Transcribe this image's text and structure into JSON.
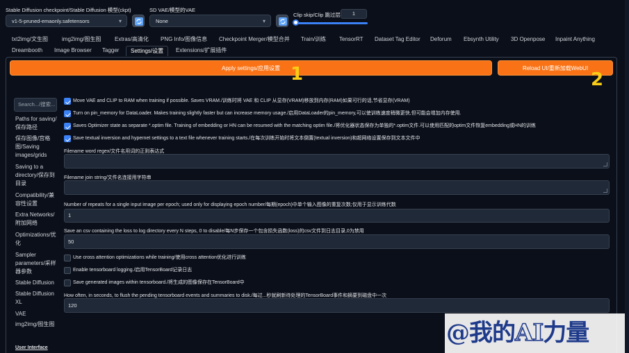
{
  "header": {
    "checkpoint_label": "Stable Diffusion checkpoint/Stable Diffusion 模型(ckpt)",
    "checkpoint_value": "v1-5-pruned-emaonly.safetensors",
    "vae_label": "SD VAE/模型的VAE",
    "vae_value": "None",
    "clip_label": "Clip skip/Clip 跳过层",
    "clip_value": "1",
    "clip_fill_fraction": 0.0
  },
  "tabs": [
    "txt2img/文生图",
    "img2img/图生图",
    "Extras/高清化",
    "PNG Info/图像信息",
    "Checkpoint Merger/模型合并",
    "Train/训练",
    "TensorRT",
    "Dataset Tag Editor",
    "Deforum",
    "Ebsynth Utility",
    "3D Openpose",
    "Inpaint Anything",
    "Dreambooth",
    "Image Browser",
    "Tagger",
    "Settings/设置",
    "Extensions/扩展插件"
  ],
  "actions": {
    "apply": "Apply settings/应用设置",
    "reload": "Reload UI/重新加载WebUI"
  },
  "annotations": [
    "1",
    "2"
  ],
  "sidebar": {
    "search_placeholder": "Search.../搜索...",
    "items": [
      "Paths for saving/保存路径",
      "保存图像/宫格图/Saving images/grids",
      "Saving to a directory/保存到目录",
      "Compatibility/兼容性设置",
      "Extra Networks/附加网络",
      "Optimizations/优化",
      "Sampler parameters/采样器参数",
      "Stable Diffusion",
      "Stable Diffusion XL",
      "VAE",
      "img2img/图生图",
      "User Interface"
    ]
  },
  "settings": {
    "cb1": "Move VAE and CLIP to RAM when training if possible. Saves VRAM./训练时将 VAE 和 CLIP 从显存(VRAM)移放到内存(RAM)如果可行的话,节省显存(VRAM)",
    "cb2": "Turn on pin_memory for DataLoader. Makes training slightly faster but can increase memory usage./启用DataLoader的pin_memory,可以使训练速度稍微更快,但可能会增加内存使用.",
    "cb3": "Saves Optimizer state as separate *.optim file. Training of embedding or HN can be resumed with the matching optim file./将优化器状态保存为单独的*.optim文件.可以使用匹配的optim文件恢复embedding或HN的训练",
    "cb4": "Save textual inversion and hypernet settings to a text file whenever training starts./在每次训练开始时将文本倒置(textual inversion)和超网络设置保存到文本文件中",
    "word_regex_label": "Filename word regex/文件名用词的正则表达式",
    "word_regex_value": "",
    "join_label": "Filename join string/文件名连接用字符串",
    "join_value": "",
    "repeats_label": "Number of repeats for a single input image per epoch; used only for displaying epoch number/每期(epoch)中单个输入图像的重复次数;仅用于显示训练代数",
    "repeats_value": "1",
    "csv_label": "Save an csv containing the loss to log directory every N steps, 0 to disable/每N步保存一个包含损失函数(loss)的csv文件到日志目录,0为禁用",
    "csv_value": "50",
    "cb5": "Use cross attention optimizations while training/使用cross attention优化进行训练",
    "cb6": "Enable tensorboard logging./启用TensorBoard记录日志",
    "cb7": "Save generated images within tensorboard./将生成的图像保存在TensorBoard中",
    "flush_label": "How often, in seconds, to flush the pending tensorboard events and summaries to disk./每过...秒就刷新待处理的TensorBoard事件和摘要到磁盘中一次",
    "flush_value": "120"
  },
  "watermark": {
    "prefix": "@我的",
    "ai": "AI",
    "suffix": "力量"
  },
  "colors": {
    "accent": "#f97316",
    "checkbox": "#3b82f6",
    "background": "#0b0f19",
    "annotation": "#facc15"
  }
}
